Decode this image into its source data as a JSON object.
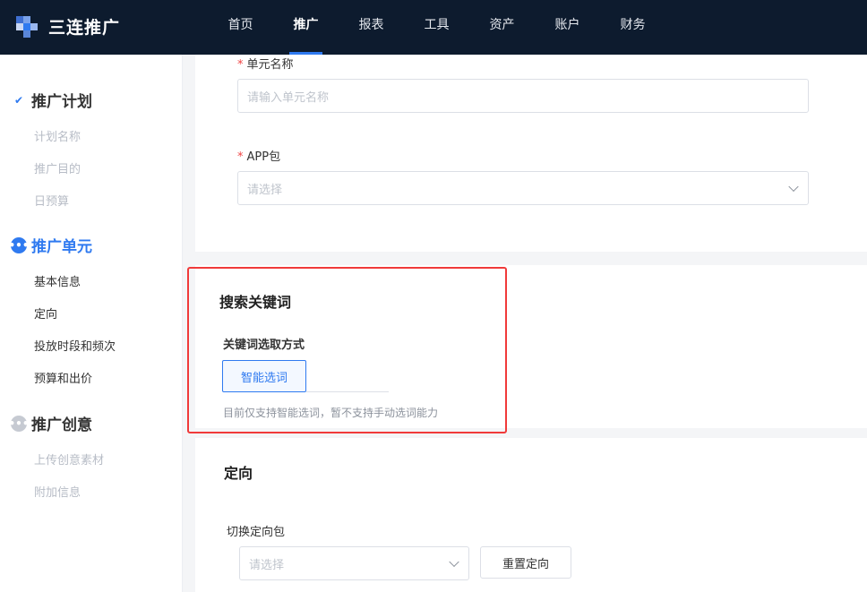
{
  "app": {
    "title": "三连推广"
  },
  "nav": {
    "items": [
      "首页",
      "推广",
      "报表",
      "工具",
      "资产",
      "账户",
      "财务"
    ],
    "active": "推广"
  },
  "sidebar": {
    "plan": {
      "title": "推广计划",
      "items": [
        "计划名称",
        "推广目的",
        "日预算"
      ]
    },
    "unit": {
      "title": "推广单元",
      "items": [
        "基本信息",
        "定向",
        "投放时段和频次",
        "预算和出价"
      ]
    },
    "creative": {
      "title": "推广创意",
      "items": [
        "上传创意素材",
        "附加信息"
      ]
    }
  },
  "form": {
    "unit_name": {
      "label": "单元名称",
      "placeholder": "请输入单元名称"
    },
    "app_pkg": {
      "label": "APP包",
      "placeholder": "请选择"
    }
  },
  "keyword": {
    "title": "搜索关键词",
    "method_label": "关键词选取方式",
    "option": "智能选词",
    "hint": "目前仅支持智能选词，暂不支持手动选词能力"
  },
  "targeting": {
    "title": "定向",
    "pkg_label": "切换定向包",
    "pkg_placeholder": "请选择",
    "reset_button": "重置定向"
  },
  "colors": {
    "accent": "#2f7af0",
    "nav_bg": "#0d1b2e",
    "highlight": "#f03a3a",
    "required": "#f04343"
  }
}
